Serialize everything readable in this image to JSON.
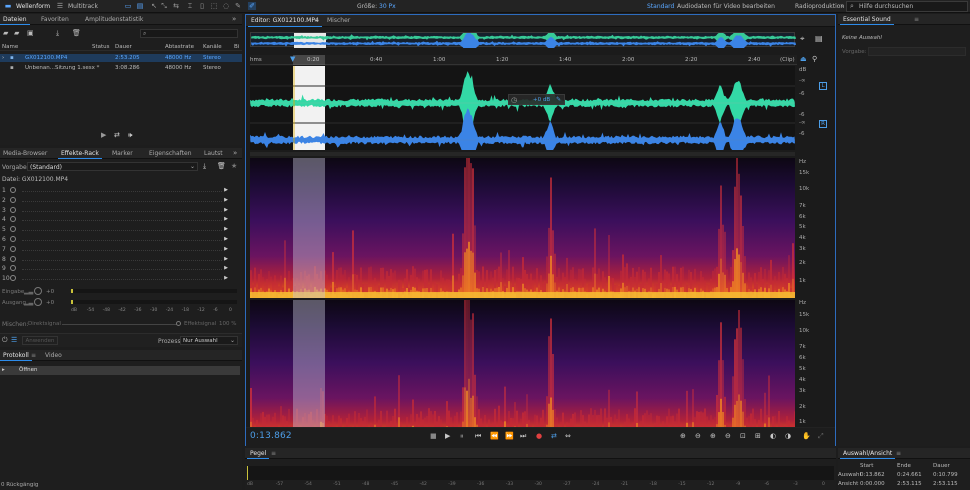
{
  "topbar": {
    "waveform_label": "Wellenform",
    "multitrack_label": "Multitrack",
    "size_label": "Größe:",
    "size_value": "30 Px",
    "workspaces": [
      "Standard",
      "Audiodaten für Video bearbeiten",
      "Radioproduktion"
    ],
    "search_placeholder": "Hilfe durchsuchen"
  },
  "files_panel": {
    "tabs": [
      "Dateien",
      "Favoriten",
      "Amplitudenstatistik"
    ],
    "search_placeholder": "",
    "columns": [
      "Name",
      "Status",
      "Dauer",
      "Abtastrate",
      "Kanäle",
      "Bi"
    ],
    "rows": [
      {
        "name": "GX012100.MP4",
        "status": "",
        "duration": "2:53.205",
        "rate": "48000 Hz",
        "channels": "Stereo",
        "selected": true
      },
      {
        "name": "Unbenan...Sitzung 1.sesx *",
        "status": "",
        "duration": "3:08.286",
        "rate": "48000 Hz",
        "channels": "Stereo",
        "selected": false
      }
    ]
  },
  "effects_panel": {
    "tabs": [
      "Media-Browser",
      "Effekte-Rack",
      "Marker",
      "Eigenschaften",
      "Lautst"
    ],
    "preset_label": "Vorgaben:",
    "preset_value": "(Standard)",
    "file_label": "Datei: GX012100.MP4",
    "slots": [
      "1",
      "2",
      "3",
      "4",
      "5",
      "6",
      "7",
      "8",
      "9",
      "10"
    ],
    "input_label": "Eingabe",
    "output_label": "Ausgang",
    "input_db": "+0",
    "output_db": "+0",
    "meter_scale": [
      "dB",
      "-54",
      "-48",
      "-42",
      "-36",
      "-30",
      "-24",
      "-18",
      "-12",
      "-6",
      "0"
    ],
    "mix_label": "Mischen:",
    "dry_label": "Direktsignal",
    "wet_label": "Effektsignal",
    "wet_value": "100 %",
    "apply_label": "Anwenden",
    "process_label": "Prozess:",
    "process_value": "Nur Auswahl"
  },
  "history_panel": {
    "tabs": [
      "Protokoll",
      "Video"
    ],
    "items": [
      "Öffnen"
    ],
    "undo_label": "0 Rückgängig"
  },
  "editor": {
    "tabs": [
      "Editor: GX012100.MP4",
      "Mischer"
    ],
    "ruler_unit": "hms",
    "ruler_ticks": [
      "0:20",
      "0:40",
      "1:00",
      "1:20",
      "1:40",
      "2:00",
      "2:20",
      "2:40"
    ],
    "clip_label": "(Clip)",
    "gain_hud": "+0 dB",
    "db_labels": [
      "dB",
      "-∞",
      "-6",
      "-6",
      "-∞",
      "-6"
    ],
    "channel_left": "L",
    "channel_right": "R",
    "hz_labels": [
      "Hz",
      "15k",
      "10k",
      "7k",
      "6k",
      "5k",
      "4k",
      "3k",
      "2k",
      "1k"
    ],
    "timecode": "0:13.862"
  },
  "essential_sound": {
    "title": "Essential Sound",
    "status": "Keine Auswahl",
    "preset_label": "Vorgabe:"
  },
  "levels_panel": {
    "title": "Pegel",
    "scale": [
      "dB",
      "-57",
      "-54",
      "-51",
      "-48",
      "-45",
      "-42",
      "-39",
      "-36",
      "-33",
      "-30",
      "-27",
      "-24",
      "-21",
      "-18",
      "-15",
      "-12",
      "-9",
      "-6",
      "-3",
      "0"
    ]
  },
  "selection_panel": {
    "title": "Auswahl/Ansicht",
    "columns": [
      "Start",
      "Ende",
      "Dauer"
    ],
    "rows": [
      {
        "label": "Auswahl",
        "start": "0:13.862",
        "end": "0:24.661",
        "duration": "0:10.799"
      },
      {
        "label": "Ansicht",
        "start": "0:00.000",
        "end": "2:53.115",
        "duration": "2:53.115"
      }
    ]
  },
  "colors": {
    "accent": "#2d8ceb",
    "wave_left": "#33d9a6",
    "wave_right": "#3b84e6",
    "timecode": "#4d9ee8"
  }
}
